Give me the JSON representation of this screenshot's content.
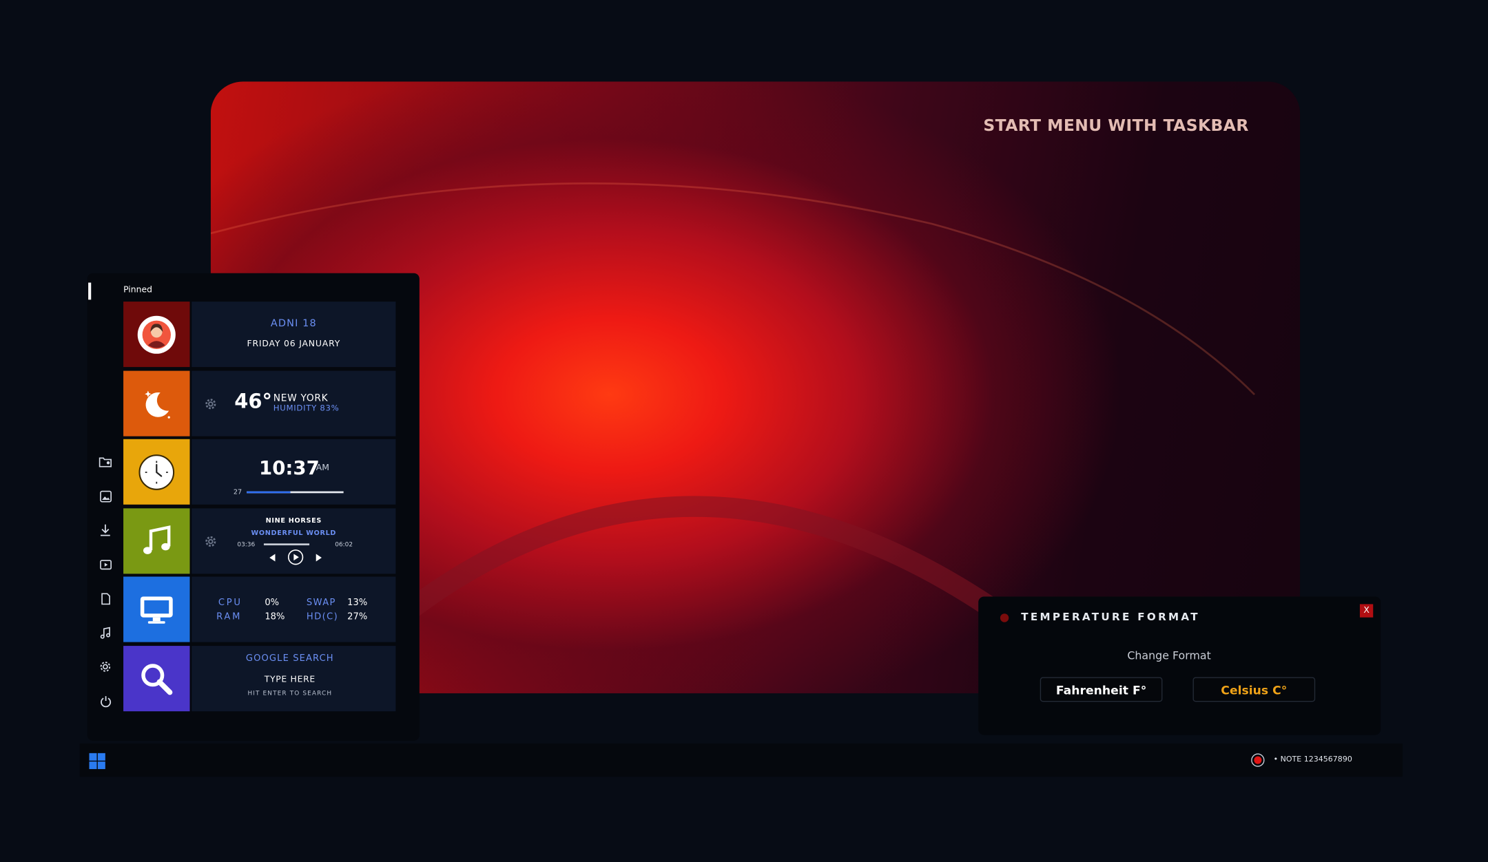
{
  "wallpaper": {
    "title": "START MENU WITH TASKBAR"
  },
  "start_menu": {
    "pinned_label": "Pinned",
    "rail_icons": [
      "folder-user-icon",
      "image-icon",
      "download-icon",
      "video-icon",
      "document-icon",
      "music-note-icon",
      "gear-icon",
      "power-icon"
    ],
    "user": {
      "name": "ADNI 18",
      "date": "FRIDAY 06 JANUARY",
      "tile_color": "#6f0a0a"
    },
    "weather": {
      "temperature": "46°",
      "city": "NEW YORK",
      "humidity": "HUMIDITY 83%",
      "tile_color": "#dd5a0c"
    },
    "clock": {
      "time": "10:37",
      "meridiem": "AM",
      "seconds": "27",
      "progress": 0.45,
      "tile_color": "#e8a60b"
    },
    "music": {
      "artist": "NINE HORSES",
      "track": "WONDERFUL WORLD",
      "elapsed": "03:36",
      "duration": "06:02",
      "tile_color": "#7a9913"
    },
    "system": {
      "cpu_label": "CPU",
      "cpu_value": "0%",
      "ram_label": "RAM",
      "ram_value": "18%",
      "swap_label": "SWAP",
      "swap_value": "13%",
      "hd_label": "HD(C)",
      "hd_value": "27%",
      "tile_color": "#1d6fe0"
    },
    "search": {
      "title": "GOOGLE SEARCH",
      "placeholder": "TYPE HERE",
      "hint": "HIT ENTER TO SEARCH",
      "tile_color": "#4a35c9"
    }
  },
  "taskbar": {
    "note": "• NOTE 1234567890"
  },
  "temperature_dialog": {
    "title": "TEMPERATURE FORMAT",
    "close_label": "X",
    "subtitle": "Change Format",
    "fahrenheit_label": "Fahrenheit  F°",
    "celsius_label": "Celsius  C°",
    "accent": "#f0a318"
  }
}
